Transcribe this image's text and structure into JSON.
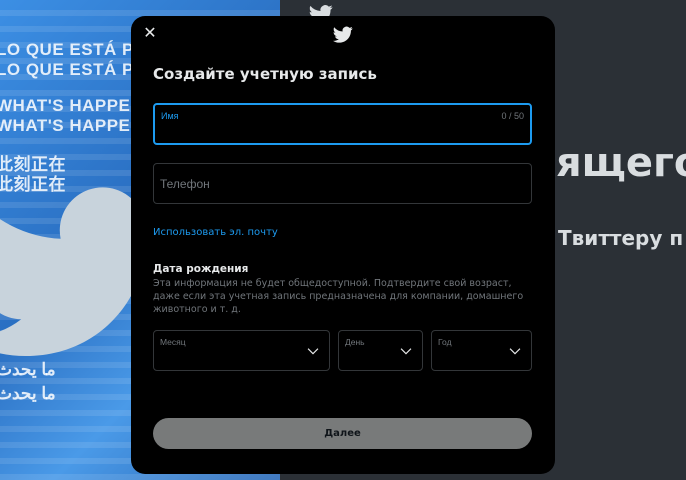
{
  "background": {
    "collage_lines": [
      "LO QUE ESTÁ PAS",
      "LO QUE ESTÁ PAS",
      "WHAT'S HAPPENIN",
      "WHAT'S HAPPENIN",
      "此刻正在",
      "此刻正在",
      "ما يحدث",
      "ما يحدث"
    ],
    "headline_fragment": "ящего",
    "subtext_fragment": "Твиттеру п",
    "accent_color": "#1d9bf0"
  },
  "modal": {
    "close_icon": "close-icon",
    "close_glyph": "✕",
    "logo_icon": "twitter-bird-icon",
    "title": "Создайте учетную запись",
    "name_field": {
      "label": "Имя",
      "value": "",
      "counter": "0 / 50"
    },
    "phone_field": {
      "placeholder": "Телефон"
    },
    "use_email_link": "Использовать эл. почту",
    "dob": {
      "title": "Дата рождения",
      "description": "Эта информация не будет общедоступной. Подтвердите свой возраст, даже если эта учетная запись предназначена для компании, домашнего животного и т. д.",
      "month_label": "Месяц",
      "day_label": "День",
      "year_label": "Год"
    },
    "next_button": "Далее"
  }
}
